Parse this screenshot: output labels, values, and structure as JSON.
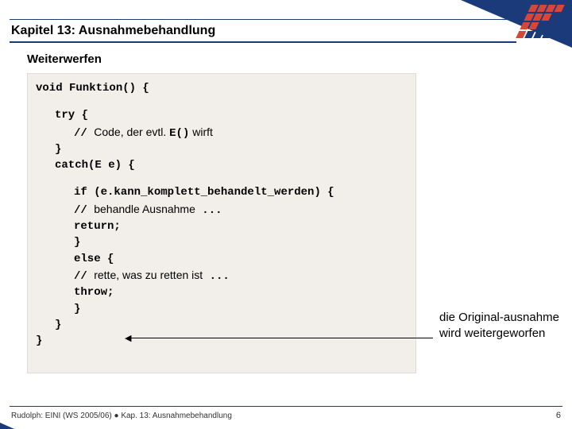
{
  "chapter": "Kapitel 13: Ausnahmebehandlung",
  "subtitle": "Weiterwerfen",
  "code": {
    "l1": "void Funktion() {",
    "l2": "try {",
    "l3a": "// ",
    "l3b": "Code, der evtl. ",
    "l3c": "E()",
    "l3d": " wirft",
    "l4": "}",
    "l5": "catch(E e) {",
    "l6": "if (e.kann_komplett_behandelt_werden) {",
    "l7a": " // ",
    "l7b": "behandle Ausnahme",
    "l7c": " ...",
    "l8": " return;",
    "l9": "}",
    "l10": "else {",
    "l11a": " // ",
    "l11b": "rette, was zu retten ist",
    "l11c": " ...",
    "l12": " throw;",
    "l13": "}",
    "l14": "}",
    "l15": "}"
  },
  "annotation": "die Original-ausnahme wird weitergeworfen",
  "footer": "Rudolph: EINI (WS 2005/06)  ●  Kap. 13: Ausnahmebehandlung",
  "page": "6"
}
